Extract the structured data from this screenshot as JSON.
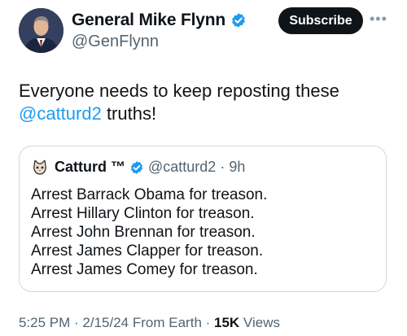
{
  "author": {
    "name": "General Mike Flynn",
    "handle": "@GenFlynn",
    "avatar_icon": "profile-photo"
  },
  "header": {
    "subscribe_label": "Subscribe",
    "more_icon": "more-horizontal-icon"
  },
  "tweet": {
    "text_before": "Everyone needs to keep reposting these",
    "mention": "@catturd2",
    "text_after": " truths!"
  },
  "quote": {
    "name": "Catturd ™",
    "handle": "@catturd2",
    "separator": "·",
    "time": "9h",
    "lines": [
      "Arrest Barrack Obama for treason.",
      "Arrest Hillary Clinton for treason.",
      "Arrest John Brennan for treason.",
      "Arrest James Clapper for treason.",
      "Arrest James Comey for treason."
    ]
  },
  "meta": {
    "time": "5:25 PM",
    "sep1": " · ",
    "date": "2/15/24",
    "source": " From Earth",
    "sep2": " · ",
    "views_count": "15K",
    "views_label": " Views"
  },
  "colors": {
    "verified_blue": "#1d9bf0",
    "mention": "#1d9bf0",
    "secondary_text": "#536471"
  }
}
